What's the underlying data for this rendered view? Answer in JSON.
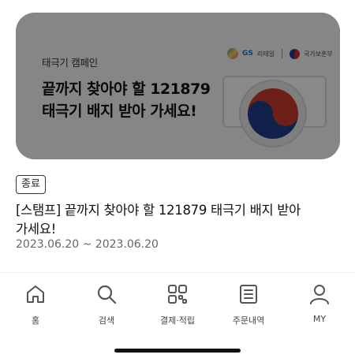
{
  "banner": {
    "campaign_label": "태극기 캠페인",
    "headline_line1": "끝까지 찾아야 할 121879",
    "headline_line2": "태극기 배지 받아 가세요!",
    "logos": {
      "gs": "GS",
      "gs_sub": "리테일",
      "gov": "국가보훈부"
    }
  },
  "event": {
    "status": "종료",
    "title": "[스탬프] 끝까지 찾아야 할 121879 태극기 배지 받아 가세요!",
    "date": "2023.06.20 ~ 2023.06.20"
  },
  "nav": {
    "items": [
      {
        "label": "홈",
        "icon": "home-icon"
      },
      {
        "label": "검색",
        "icon": "search-icon"
      },
      {
        "label": "결제·적립",
        "icon": "payment-icon"
      },
      {
        "label": "주문내역",
        "icon": "order-history-icon"
      },
      {
        "label": "MY",
        "icon": "person-icon"
      }
    ]
  },
  "colors": {
    "overlay": "#000000",
    "taeguk_red": "#c0392b",
    "taeguk_blue": "#1f3c88"
  }
}
